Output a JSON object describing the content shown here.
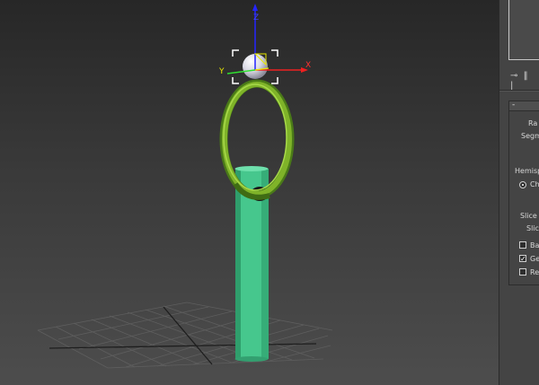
{
  "viewport": {
    "gizmo": {
      "x_label": "X",
      "y_label": "Y",
      "z_label": "Z"
    }
  },
  "panel": {
    "rollout_toggle": "-",
    "params": {
      "radius_label": "Ra",
      "segments_label": "Segme",
      "hemisphere_label": "Hemisph",
      "chop_label": "Ch",
      "slice_from_label": "Slice F",
      "slice_to_label": "Slic",
      "base_to_pivot_label": "Ba",
      "generate_mapping_label": "Ge",
      "generate_mapping_check": "✓",
      "real_world_label": "Re"
    },
    "colors": {
      "cylinder": "#46c78d",
      "torus": "#7fb329",
      "sphere": "#e6e6ee"
    }
  }
}
